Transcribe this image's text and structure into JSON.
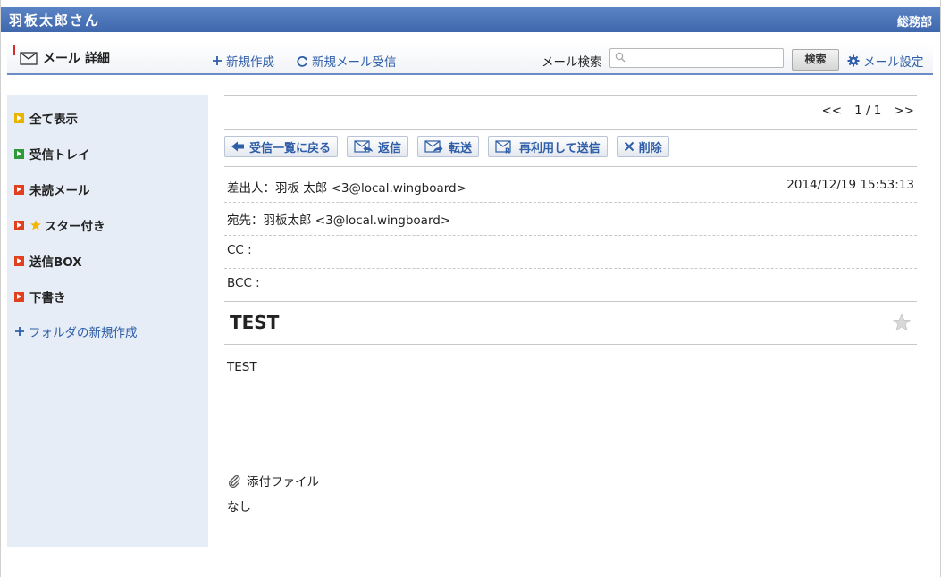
{
  "user_bar": {
    "user_name": "羽板太郎さん",
    "department": "総務部"
  },
  "header": {
    "title": "メール 詳細",
    "new_mail": "新規作成",
    "receive_mail": "新規メール受信",
    "search_label": "メール検索",
    "search_value": "",
    "search_placeholder": "",
    "search_button": "検索",
    "settings": "メール設定"
  },
  "sidebar": {
    "items": [
      {
        "label": "全て表示",
        "color": "#e8b400"
      },
      {
        "label": "受信トレイ",
        "color": "#2f9a3a"
      },
      {
        "label": "未読メール",
        "color": "#e0401e"
      },
      {
        "label": "スター付き",
        "color": "#e0401e",
        "icon": "star-icon"
      },
      {
        "label": "送信BOX",
        "color": "#e0401e"
      },
      {
        "label": "下書き",
        "color": "#e0401e"
      }
    ],
    "new_folder": "フォルダの新規作成"
  },
  "pager": {
    "prev": "<<",
    "current": "1 / 1",
    "next": ">>"
  },
  "actions": {
    "back": "受信一覧に戻る",
    "reply": "返信",
    "forward": "転送",
    "reuse": "再利用して送信",
    "delete": "削除"
  },
  "mail": {
    "from": "差出人：羽板 太郎 <3@local.wingboard>",
    "date": "2014/12/19 15:53:13",
    "to": "宛先：羽板太郎 <3@local.wingboard>",
    "cc": "CC :",
    "bcc": "BCC :",
    "subject": "TEST",
    "body": "TEST",
    "attachments_label": "添付ファイル",
    "attachments_value": "なし"
  },
  "colors": {
    "accent": "#4a74b9",
    "link": "#2f5ea8",
    "sidebar_bg": "#e7edf6"
  }
}
